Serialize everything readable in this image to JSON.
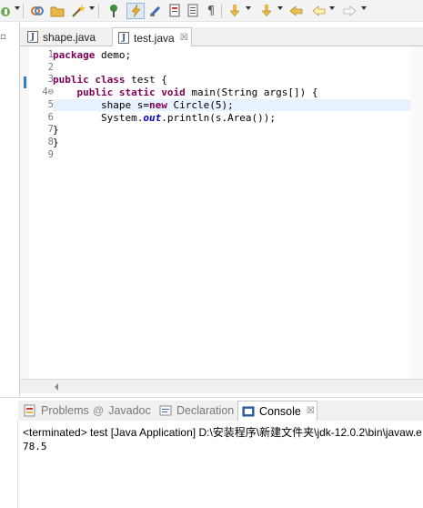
{
  "toolbar": {
    "icons": [
      "java-overlay-icon",
      "link-icon",
      "folder-icon",
      "magic-wand-icon",
      "pin-icon",
      "lightning-icon",
      "pencil-icon",
      "document-icon",
      "page-icon",
      "pilcrow-icon",
      "down-arrow-icon",
      "down-arrow-2-icon",
      "back-arrow-icon",
      "back-icon",
      "forward-icon"
    ]
  },
  "editor": {
    "tabs": [
      {
        "label": "shape.java",
        "active": false
      },
      {
        "label": "test.java",
        "active": true,
        "close": "☒"
      }
    ],
    "lines": [
      {
        "n": "1",
        "code": [
          {
            "t": "package",
            "k": "kw"
          },
          {
            "t": " demo;"
          }
        ]
      },
      {
        "n": "2",
        "code": []
      },
      {
        "n": "3",
        "code": [
          {
            "t": "public",
            "k": "kw"
          },
          {
            "t": " "
          },
          {
            "t": "class",
            "k": "kw"
          },
          {
            "t": " test {"
          }
        ]
      },
      {
        "n": "4⊖",
        "code": [
          {
            "t": "    "
          },
          {
            "t": "public",
            "k": "kw"
          },
          {
            "t": " "
          },
          {
            "t": "static",
            "k": "kw"
          },
          {
            "t": " "
          },
          {
            "t": "void",
            "k": "kw"
          },
          {
            "t": " main(String args[]) {"
          }
        ]
      },
      {
        "n": "5",
        "code": [
          {
            "t": "        shape s="
          },
          {
            "t": "new",
            "k": "kw"
          },
          {
            "t": " Circle(5);"
          }
        ],
        "highlight": true
      },
      {
        "n": "6",
        "code": [
          {
            "t": "        System."
          },
          {
            "t": "out",
            "k": "it"
          },
          {
            "t": ".println(s.Area());"
          }
        ]
      },
      {
        "n": "7",
        "code": [
          {
            "t": "}"
          }
        ]
      },
      {
        "n": "8",
        "code": [
          {
            "t": "}"
          }
        ]
      },
      {
        "n": "9",
        "code": []
      }
    ]
  },
  "bottom": {
    "tabs": [
      {
        "label": "Problems",
        "icon": "problems-icon"
      },
      {
        "label": "Javadoc",
        "icon": "at-icon"
      },
      {
        "label": "Declaration",
        "icon": "declaration-icon"
      },
      {
        "label": "Console",
        "icon": "console-icon",
        "active": true,
        "close": "☒"
      }
    ],
    "terminated": "<terminated> test [Java Application] D:\\安装程序\\新建文件夹\\jdk-12.0.2\\bin\\javaw.e",
    "output": "78.5"
  },
  "colors": {
    "keyword": "#7f0055",
    "static_field": "#0000c0",
    "current_line": "#e8f2fe"
  }
}
